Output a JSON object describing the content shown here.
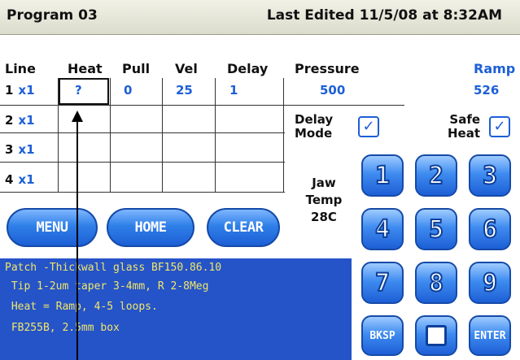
{
  "header": {
    "program": "Program 03",
    "last_edited": "Last Edited 11/5/08 at 8:32AM"
  },
  "table": {
    "headers": [
      "Line",
      "Heat",
      "Pull",
      "Vel",
      "Delay",
      "Pressure",
      "Ramp"
    ],
    "row1": {
      "line": "1",
      "mult": "x1",
      "heat": "?",
      "pull": "0",
      "vel": "25",
      "delay": "1",
      "pressure": "500",
      "ramp": "526"
    },
    "lines": [
      {
        "num": "2",
        "mult": "x1"
      },
      {
        "num": "3",
        "mult": "x1"
      },
      {
        "num": "4",
        "mult": "x1"
      }
    ]
  },
  "options": {
    "delay_mode_1": "Delay",
    "delay_mode_2": "Mode",
    "delay_mode_checked": true,
    "safe_heat_1": "Safe",
    "safe_heat_2": "Heat",
    "safe_heat_checked": true,
    "check_glyph": "✓"
  },
  "jaw": {
    "line1": "Jaw",
    "line2": "Temp",
    "value": "28C"
  },
  "buttons": {
    "menu": "MENU",
    "home": "HOME",
    "clear": "CLEAR"
  },
  "keypad": {
    "k1": "1",
    "k2": "2",
    "k3": "3",
    "k4": "4",
    "k5": "5",
    "k6": "6",
    "k7": "7",
    "k8": "8",
    "k9": "9",
    "bksp": "BKSP",
    "enter": "ENTER"
  },
  "notes": [
    "Patch -Thickwall glass BF150.86.10",
    " Tip 1-2um taper 3-4mm, R 2-8Meg",
    " Heat = Ramp, 4-5 loops.",
    " FB255B, 2.5mm box"
  ],
  "colors": {
    "accent_blue": "#1d5fd6",
    "notes_bg": "#2553c8",
    "notes_text": "#f0e76a"
  }
}
